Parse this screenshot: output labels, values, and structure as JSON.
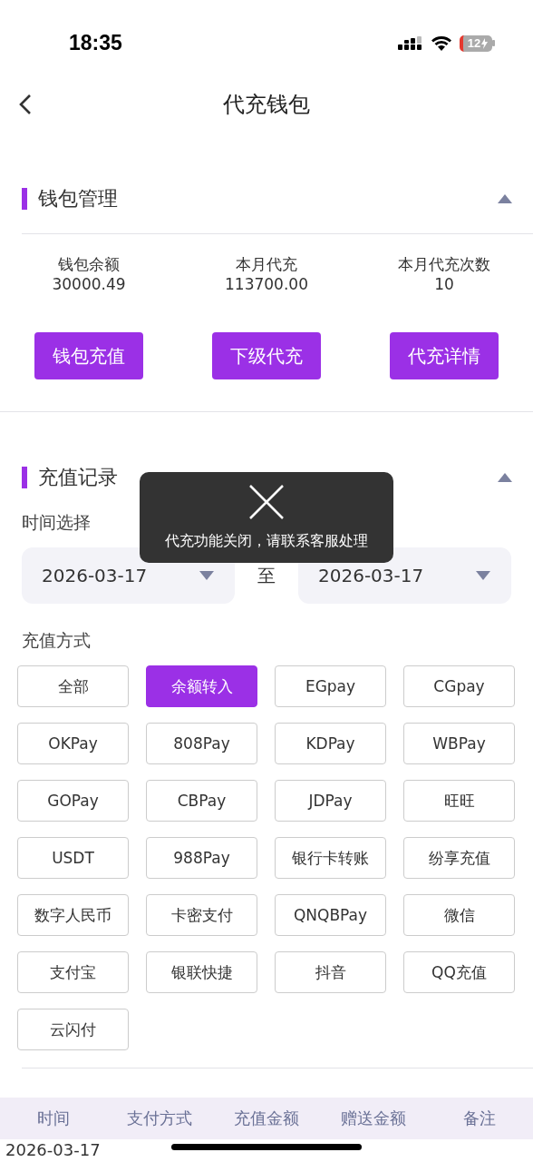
{
  "status_bar": {
    "time": "18:35",
    "battery": "12"
  },
  "header": {
    "title": "代充钱包"
  },
  "wallet": {
    "title": "钱包管理",
    "expanded": true,
    "stats": [
      {
        "label": "钱包余额",
        "value": "30000.49"
      },
      {
        "label": "本月代充",
        "value": "113700.00"
      },
      {
        "label": "本月代充次数",
        "value": "10"
      }
    ],
    "buttons": [
      "钱包充值",
      "下级代充",
      "代充详情"
    ]
  },
  "records": {
    "title": "充值记录",
    "expanded": true,
    "time_label": "时间选择",
    "start_date": "2026-03-17",
    "separator": "至",
    "end_date": "2026-03-17",
    "method_label": "充值方式",
    "methods": [
      {
        "label": "全部",
        "selected": false
      },
      {
        "label": "余额转入",
        "selected": true
      },
      {
        "label": "EGpay",
        "selected": false
      },
      {
        "label": "CGpay",
        "selected": false
      },
      {
        "label": "OKPay",
        "selected": false
      },
      {
        "label": "808Pay",
        "selected": false
      },
      {
        "label": "KDPay",
        "selected": false
      },
      {
        "label": "WBPay",
        "selected": false
      },
      {
        "label": "GOPay",
        "selected": false
      },
      {
        "label": "CBPay",
        "selected": false
      },
      {
        "label": "JDPay",
        "selected": false
      },
      {
        "label": "旺旺",
        "selected": false
      },
      {
        "label": "USDT",
        "selected": false
      },
      {
        "label": "988Pay",
        "selected": false
      },
      {
        "label": "银行卡转账",
        "selected": false
      },
      {
        "label": "纷享充值",
        "selected": false
      },
      {
        "label": "数字人民币",
        "selected": false
      },
      {
        "label": "卡密支付",
        "selected": false
      },
      {
        "label": "QNQBPay",
        "selected": false
      },
      {
        "label": "微信",
        "selected": false
      },
      {
        "label": "支付宝",
        "selected": false
      },
      {
        "label": "银联快捷",
        "selected": false
      },
      {
        "label": "抖音",
        "selected": false
      },
      {
        "label": "QQ充值",
        "selected": false
      },
      {
        "label": "云闪付",
        "selected": false
      }
    ]
  },
  "table": {
    "columns": [
      "时间",
      "支付方式",
      "充值金额",
      "赠送金额",
      "备注"
    ],
    "rows": [
      [
        "2026-03-17"
      ]
    ]
  },
  "toast": {
    "message": "代充功能关闭，请联系客服处理"
  }
}
